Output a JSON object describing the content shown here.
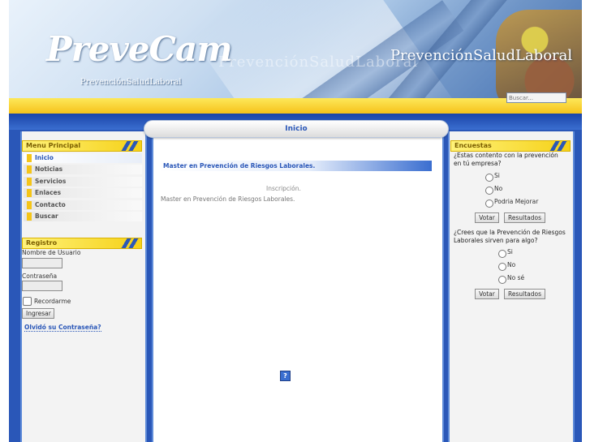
{
  "header": {
    "logo_text": "PreveCam",
    "logo_subtitle": "PrevenciónSaludLaboral",
    "banner_watermark": "PrevenciónSaludLaboral",
    "tagline": "PrevenciónSaludLaboral",
    "search_placeholder": "Buscar..."
  },
  "center": {
    "tab_title": "Inicio",
    "article_title": "Master en Prevención de Riesgos Laborales.",
    "inscription_link": "Inscripción.",
    "article_text": "Master en Prevención de Riesgos Laborales.",
    "help_icon_glyph": "?"
  },
  "menu": {
    "title": "Menu Principal",
    "items": [
      {
        "label": "Inicio"
      },
      {
        "label": "Noticias"
      },
      {
        "label": "Servicios"
      },
      {
        "label": "Enlaces"
      },
      {
        "label": "Contacto"
      },
      {
        "label": "Buscar"
      }
    ]
  },
  "login": {
    "title": "Registro",
    "username_label": "Nombre de Usuario",
    "password_label": "Contraseña",
    "remember_label": "Recordarme",
    "submit_label": "Ingresar",
    "forgot_link": "Olvidó su Contraseña?"
  },
  "polls": {
    "title": "Encuestas",
    "poll1": {
      "question": "¿Estas contento con la prevención en tú empresa?",
      "options": [
        "Si",
        "No",
        "Podria Mejorar"
      ],
      "vote_label": "Votar",
      "results_label": "Resultados"
    },
    "poll2": {
      "question": "¿Crees que la Prevención de Riesgos Laborales sirven para algo?",
      "options": [
        "Si",
        "No",
        "No sé"
      ],
      "vote_label": "Votar",
      "results_label": "Resultados"
    }
  },
  "colors": {
    "brand_blue": "#2a57b8",
    "accent_yellow": "#f5d117"
  }
}
